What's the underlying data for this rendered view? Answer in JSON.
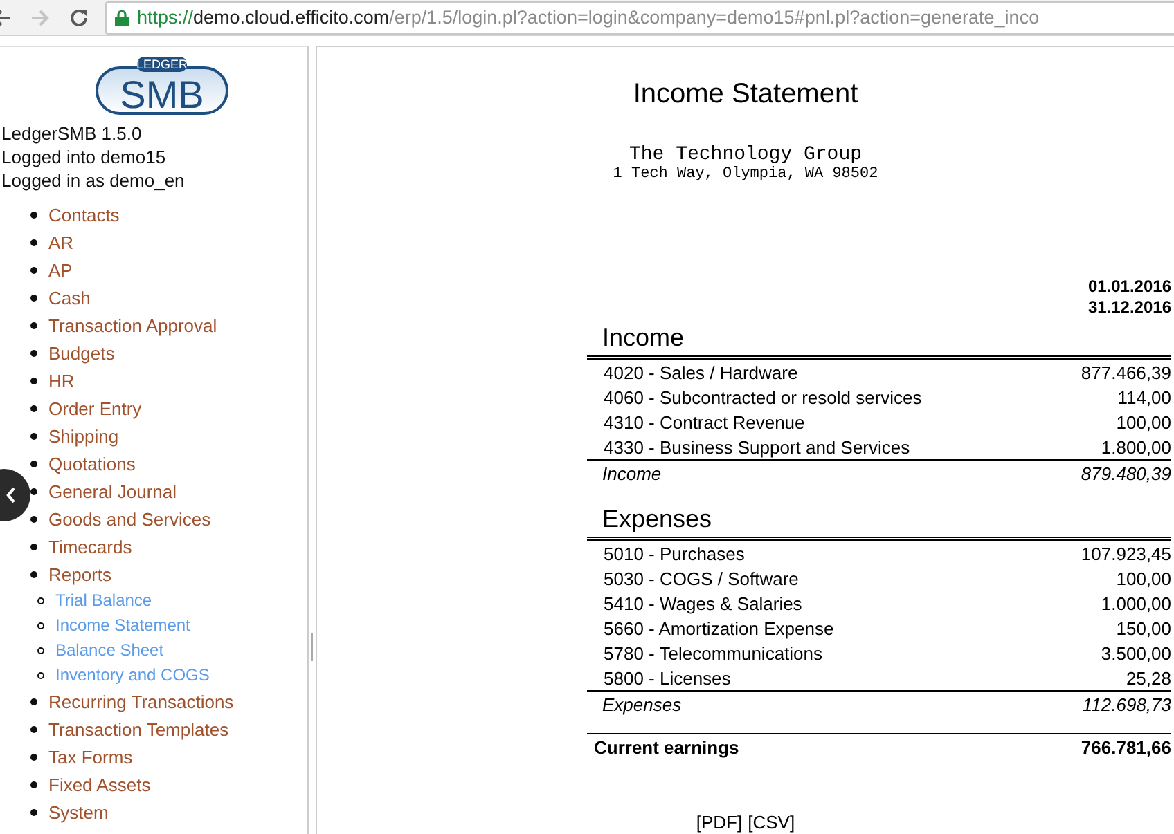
{
  "browser": {
    "url": {
      "scheme": "https://",
      "host": "demo.cloud.efficito.com",
      "path": "/erp/1.5/login.pl?action=login&company=demo15#pnl.pl?action=generate_inco"
    }
  },
  "sidebar": {
    "logo": {
      "top": "LEDGER",
      "main": "SMB"
    },
    "version": "LedgerSMB 1.5.0",
    "login_db": "Logged into demo15",
    "login_user": "Logged in as demo_en",
    "menu": [
      {
        "label": "Contacts"
      },
      {
        "label": "AR"
      },
      {
        "label": "AP"
      },
      {
        "label": "Cash"
      },
      {
        "label": "Transaction Approval"
      },
      {
        "label": "Budgets"
      },
      {
        "label": "HR"
      },
      {
        "label": "Order Entry"
      },
      {
        "label": "Shipping"
      },
      {
        "label": "Quotations"
      },
      {
        "label": "General Journal"
      },
      {
        "label": "Goods and Services"
      },
      {
        "label": "Timecards"
      },
      {
        "label": "Reports",
        "children": [
          {
            "label": "Trial Balance"
          },
          {
            "label": "Income Statement"
          },
          {
            "label": "Balance Sheet"
          },
          {
            "label": "Inventory and COGS"
          }
        ]
      },
      {
        "label": "Recurring Transactions"
      },
      {
        "label": "Transaction Templates"
      },
      {
        "label": "Tax Forms"
      },
      {
        "label": "Fixed Assets"
      },
      {
        "label": "System"
      }
    ]
  },
  "report": {
    "title": "Income Statement",
    "company": "The Technology Group",
    "address": "1 Tech Way, Olympia, WA 98502",
    "period": [
      "01.01.2016",
      "31.12.2016"
    ],
    "sections": [
      {
        "heading": "Income",
        "rows": [
          {
            "account": "4020 - Sales / Hardware",
            "amount": "877.466,39"
          },
          {
            "account": "4060 - Subcontracted or resold services",
            "amount": "114,00"
          },
          {
            "account": "4310 - Contract Revenue",
            "amount": "100,00"
          },
          {
            "account": "4330 - Business Support and Services",
            "amount": "1.800,00"
          }
        ],
        "total": {
          "label": "Income",
          "amount": "879.480,39"
        }
      },
      {
        "heading": "Expenses",
        "rows": [
          {
            "account": "5010 - Purchases",
            "amount": "107.923,45"
          },
          {
            "account": "5030 - COGS / Software",
            "amount": "100,00"
          },
          {
            "account": "5410 - Wages & Salaries",
            "amount": "1.000,00"
          },
          {
            "account": "5660 - Amortization Expense",
            "amount": "150,00"
          },
          {
            "account": "5780 - Telecommunications",
            "amount": "3.500,00"
          },
          {
            "account": "5800 - Licenses",
            "amount": "25,28"
          }
        ],
        "total": {
          "label": "Expenses",
          "amount": "112.698,73"
        }
      }
    ],
    "result": {
      "label": "Current earnings",
      "amount": "766.781,66"
    },
    "links": [
      "[PDF]",
      "[CSV]"
    ]
  }
}
